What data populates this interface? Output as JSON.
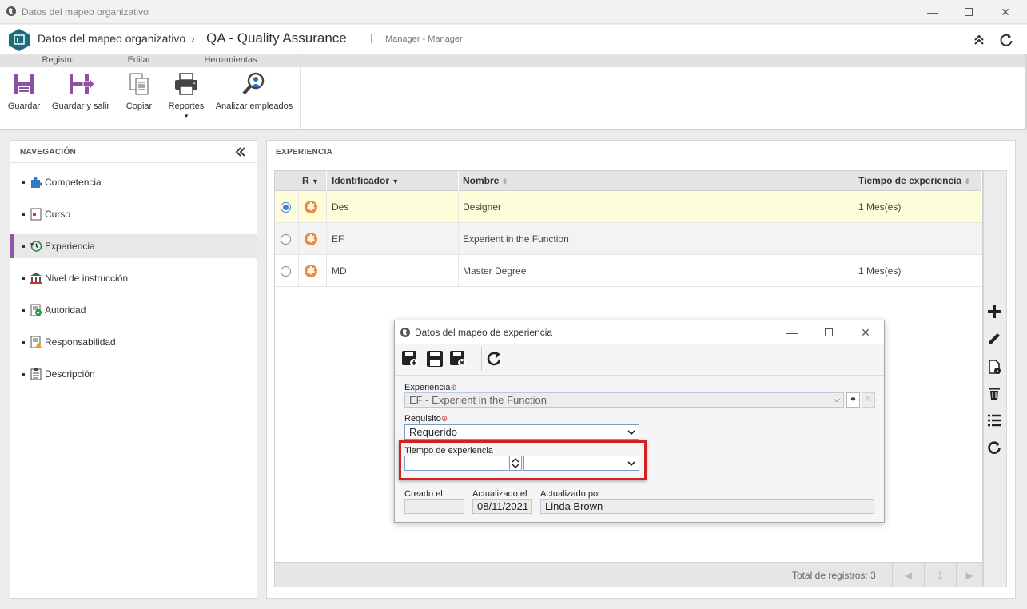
{
  "window": {
    "title": "Datos del mapeo organizativo"
  },
  "header": {
    "breadcrumb_root": "Datos del mapeo organizativo",
    "separator": "›",
    "record_title": "QA - Quality Assurance",
    "divider": "|",
    "user_context": "Manager - Manager"
  },
  "ribbon": {
    "groups": [
      {
        "label": "Registro",
        "buttons": [
          {
            "label": "Guardar",
            "icon": "save-icon"
          },
          {
            "label": "Guardar y salir",
            "icon": "save-exit-icon"
          }
        ]
      },
      {
        "label": "Editar",
        "buttons": [
          {
            "label": "Copiar",
            "icon": "copy-icon"
          }
        ]
      },
      {
        "label": "Herramientas",
        "buttons": [
          {
            "label": "Reportes",
            "icon": "printer-icon"
          },
          {
            "label": "Analizar empleados",
            "icon": "analyze-employees-icon"
          }
        ]
      }
    ]
  },
  "nav": {
    "title": "NAVEGACIÓN",
    "collapse_icon": "double-chevron-left-icon",
    "items": [
      {
        "label": "Competencia",
        "icon": "puzzle-icon"
      },
      {
        "label": "Curso",
        "icon": "course-icon"
      },
      {
        "label": "Experiencia",
        "icon": "history-icon",
        "active": true
      },
      {
        "label": "Nivel de instrucción",
        "icon": "building-icon"
      },
      {
        "label": "Autoridad",
        "icon": "authority-icon"
      },
      {
        "label": "Responsabilidad",
        "icon": "responsibility-icon"
      },
      {
        "label": "Descripción",
        "icon": "clipboard-icon"
      }
    ]
  },
  "experience": {
    "title": "EXPERIENCIA",
    "columns": {
      "r": "R",
      "id": "Identificador",
      "name": "Nombre",
      "time": "Tiempo de experiencia"
    },
    "rows": [
      {
        "id": "Des",
        "name": "Designer",
        "time": "1 Mes(es)",
        "selected": true
      },
      {
        "id": "EF",
        "name": "Experient in the Function",
        "time": "",
        "selected": false
      },
      {
        "id": "MD",
        "name": "Master Degree",
        "time": "1 Mes(es)",
        "selected": false
      }
    ],
    "footer": {
      "total": "Total de registros: 3",
      "page": "1"
    },
    "tools": [
      "add-icon",
      "edit-icon",
      "document-info-icon",
      "delete-icon",
      "list-icon",
      "refresh-icon"
    ]
  },
  "dialog": {
    "title": "Datos del mapeo de experiencia",
    "experiencia_label": "Experiencia",
    "experiencia_value": "EF - Experient in the Function",
    "requisito_label": "Requisito",
    "requisito_value": "Requerido",
    "tiempo_label": "Tiempo de experiencia",
    "tiempo_value": "",
    "tiempo_unit": "",
    "creado_label": "Creado el",
    "creado_value": "",
    "actualizado_label": "Actualizado el",
    "actualizado_value": "08/11/2021",
    "actualizado_por_label": "Actualizado por",
    "actualizado_por_value": "Linda Brown",
    "highlight_color": "#d32020"
  }
}
